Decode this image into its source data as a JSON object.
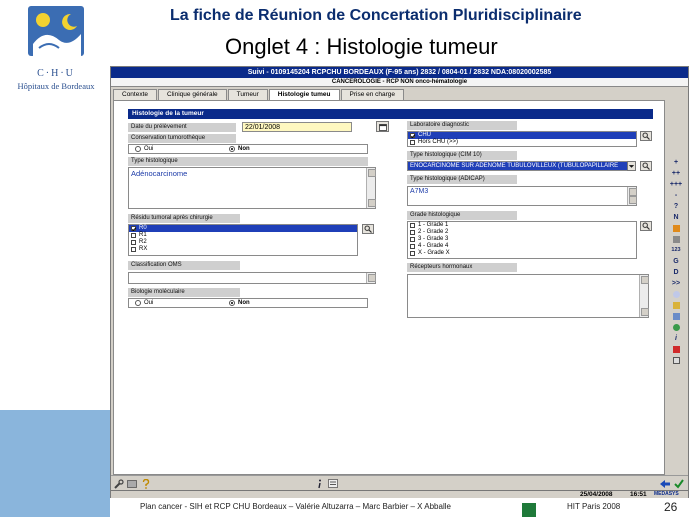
{
  "slide": {
    "title": "La fiche de Réunion de Concertation Pluridisciplinaire",
    "subtitle": "Onglet 4 : Histologie tumeur",
    "logo_text": "C·H·U",
    "logo_subtext": "Hôpitaux de Bordeaux",
    "footer": "Plan cancer - SIH et RCP CHU Bordeaux – Valérie Altuzarra – Marc Barbier – X Abballe",
    "event": "HIT Paris 2008",
    "page_number": "26"
  },
  "app": {
    "header": "Suivi - 0109145204 RCPCHU BORDEAUX (F-95 ans) 2832 / 0804-01 / 2832 NDA:08020002585",
    "subheader": "CANCEROLOGIE - RCP NON onco-hématologie",
    "tabs": [
      "Contexte",
      "Clinique générale",
      "Tumeur",
      "Histologie tumeu",
      "Prise en charge"
    ],
    "active_tab": 3,
    "section_title": "Histologie de la tumeur",
    "left": {
      "date_label": "Date du prélèvement",
      "date_value": "22/01/2008",
      "conservation_label": "Conservation tumorothèque",
      "conservation_options": [
        "Oui",
        "Non"
      ],
      "conservation_selected": "Non",
      "type_label": "Type histologique",
      "type_value": "Adénocarcinome",
      "residu_label": "Résidu tumoral après chirurgie",
      "residu_items": [
        "R0",
        "R1",
        "R2",
        "RX"
      ],
      "residu_selected": "R0",
      "oms_label": "Classification OMS",
      "oms_value": "",
      "bio_label": "Biologie moléculaire",
      "bio_options": [
        "Oui",
        "Non"
      ],
      "bio_selected": "Non"
    },
    "right": {
      "labo_label": "Laboratoire diagnostic",
      "labo_items": [
        "CHU",
        "Hors CHU (>>)"
      ],
      "labo_selected": "CHU",
      "cim_label": "Type histologique (CIM 10)",
      "cim_value": "ENOCARCINOME SUR ADENOME TUBULOVILLEUX (TUBULOPAPILLAIRE",
      "adicap_label": "Type histologique (ADICAP)",
      "adicap_value": "A7M3",
      "grade_label": "Grade histologique",
      "grade_items": [
        "1 - Grade 1",
        "2 - Grade 2",
        "3 - Grade 3",
        "4 - Grade 4",
        "X - Grade X"
      ],
      "recepteurs_label": "Récepteurs hormonaux",
      "recepteurs_value": ""
    },
    "toolbar": [
      "+",
      "++",
      "+++",
      "-",
      "?",
      "N",
      "",
      "",
      "123",
      "G",
      "D",
      ">>",
      "",
      "",
      "",
      "",
      "i",
      "",
      ""
    ],
    "status": {
      "date": "25/04/2008",
      "time": "16:51",
      "brand": "MEDASYS"
    }
  },
  "colors": {
    "title_blue": "#0b2d6e",
    "header_blue": "#0a2a8a",
    "selection_blue": "#1f3fb8",
    "band_blue": "#8ab5dc",
    "window_gray": "#d4d0c8"
  }
}
